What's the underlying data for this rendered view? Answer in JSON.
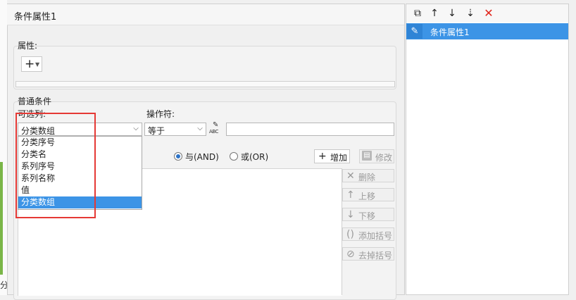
{
  "background": {
    "partial_char": "分"
  },
  "dialog": {
    "title": "条件属性1",
    "properties_label": "属性:",
    "add_icon_glyph": "+",
    "normal_conditions_label": "普通条件",
    "column_label": "可选列:",
    "operator_label": "操作符:",
    "column_select_value": "分类数组",
    "operator_select_value": "等于",
    "value_input": "",
    "dropdown_options": [
      "分类序号",
      "分类名",
      "系列序号",
      "系列名称",
      "值",
      "分类数组"
    ],
    "dropdown_selected_index": 5,
    "radio_and_label": "与(AND)",
    "radio_or_label": "或(OR)",
    "radio_selected": "and",
    "add_button": "增加",
    "edit_button": "修改",
    "delete_button": "删除",
    "move_up_button": "上移",
    "move_down_button": "下移",
    "add_bracket_button": "添加括号",
    "remove_bracket_button": "去掉括号",
    "abc_icon_text": "ABC"
  },
  "right_panel": {
    "items": [
      {
        "label": "条件属性1"
      }
    ]
  },
  "colors": {
    "selection": "#3c94e6",
    "highlight_box": "#e53935",
    "delete_icon": "#e0241a"
  },
  "icons": {
    "copy": "copy-icon",
    "up": "arrow-up-icon",
    "down": "arrow-down-icon",
    "sort": "sort-down-icon",
    "delete": "close-icon",
    "edit": "pencil-icon"
  }
}
